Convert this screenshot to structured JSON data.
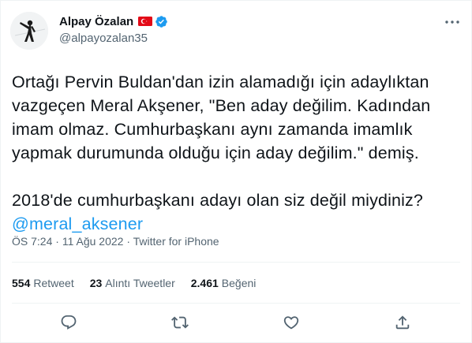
{
  "author": {
    "name": "Alpay Özalan",
    "handle": "@alpayozalan35",
    "flag_icon": "turkey-flag-icon",
    "verified_icon": "verified-badge-icon"
  },
  "tweet": {
    "text_main": "Ortağı Pervin Buldan'dan izin alamadığı için adaylıktan\nvazgeçen Meral Akşener, \"Ben aday değilim. Kadından\nimam olmaz. Cumhurbaşkanı aynı zamanda imamlık\nyapmak durumunda olduğu için aday değilim.\" demiş.\n\n2018'de cumhurbaşkanı adayı olan siz değil miydiniz?\n",
    "mention": "@meral_aksener"
  },
  "meta": {
    "time": "ÖS 7:24",
    "sep1": " · ",
    "date": "11 Ağu 2022",
    "sep2": " · ",
    "source": "Twitter for iPhone"
  },
  "stats": {
    "retweets_count": "554",
    "retweets_label": "Retweet",
    "quotes_count": "23",
    "quotes_label": "Alıntı Tweetler",
    "likes_count": "2.461",
    "likes_label": "Beğeni"
  },
  "colors": {
    "accent": "#1d9bf0",
    "text": "#0f1419",
    "secondary": "#536471",
    "flag_red": "#e30a17"
  },
  "icons": [
    "more-options-icon",
    "reply-icon",
    "retweet-icon",
    "like-icon",
    "share-icon"
  ]
}
